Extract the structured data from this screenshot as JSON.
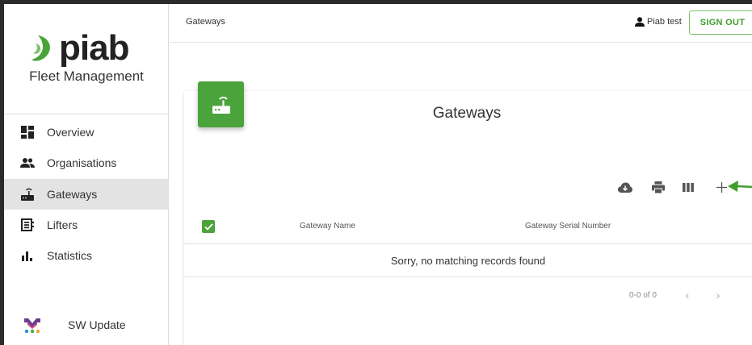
{
  "brand": {
    "logo_text": "piab",
    "subtitle": "Fleet Management",
    "accent_color": "#4aa33b"
  },
  "sidebar": {
    "items": [
      {
        "label": "Overview",
        "icon": "dashboard-icon",
        "active": false
      },
      {
        "label": "Organisations",
        "icon": "people-icon",
        "active": false
      },
      {
        "label": "Gateways",
        "icon": "router-icon",
        "active": true
      },
      {
        "label": "Lifters",
        "icon": "list-box-icon",
        "active": false
      },
      {
        "label": "Statistics",
        "icon": "bar-chart-icon",
        "active": false
      }
    ],
    "sw_update": {
      "label": "SW Update",
      "icon": "colorful-m-logo-icon"
    }
  },
  "header": {
    "breadcrumb": "Gateways",
    "user_name": "Piab test",
    "signout_label": "SIGN OUT"
  },
  "card": {
    "title": "Gateways",
    "badge_icon": "router-icon",
    "toolbar": [
      "cloud-download-icon",
      "print-icon",
      "view-columns-icon",
      "add-icon"
    ]
  },
  "table": {
    "columns": [
      "Gateway Name",
      "Gateway Serial Number"
    ],
    "empty_message": "Sorry, no matching records found",
    "pagination": "0-0 of 0"
  }
}
